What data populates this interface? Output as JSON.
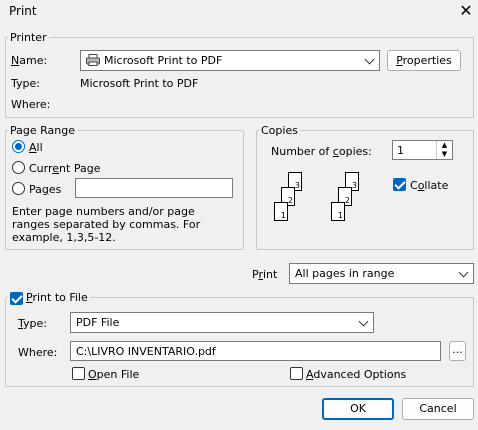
{
  "window": {
    "title": "Print",
    "close_glyph": "✕"
  },
  "printer": {
    "group_label": "Printer",
    "name_label": "Name:",
    "name_value": "Microsoft Print to PDF",
    "properties_button": "Properties",
    "type_label": "Type:",
    "type_value": "Microsoft Print to PDF",
    "where_label": "Where:"
  },
  "page_range": {
    "group_label": "Page Range",
    "options": [
      "All",
      "Current Page",
      "Pages"
    ],
    "selected": "All",
    "pages_value": "",
    "hint": "Enter page numbers and/or page ranges separated by commas.  For example, 1,3,5-12."
  },
  "copies": {
    "group_label": "Copies",
    "number_label": "Number of copies:",
    "number_value": "1",
    "collate_label": "Collate",
    "collate_checked": true,
    "collate_icon_pages": [
      "3",
      "2",
      "1",
      "3",
      "2",
      "1"
    ]
  },
  "print": {
    "label": "Print",
    "value": "All pages in range"
  },
  "print_to_file": {
    "label": "Print to File",
    "checked": true,
    "type_label": "Type:",
    "type_value": "PDF File",
    "where_label": "Where:",
    "where_value": "C:\\LIVRO INVENTARIO.pdf",
    "browse_label": "...",
    "open_file_label": "Open File",
    "open_file_checked": false,
    "advanced_label": "Advanced Options",
    "advanced_checked": false
  },
  "buttons": {
    "ok": "OK",
    "cancel": "Cancel"
  },
  "colors": {
    "accent": "#0067c0",
    "background": "#f0f0f0"
  }
}
